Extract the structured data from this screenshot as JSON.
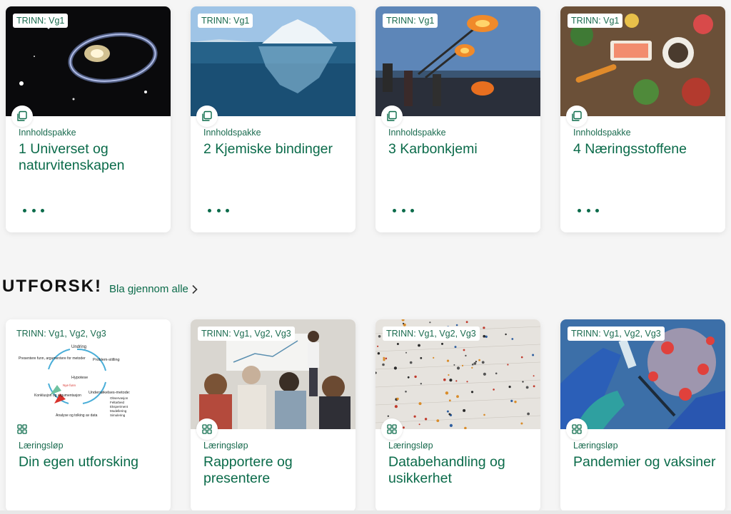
{
  "top_cards": [
    {
      "tag": "TRINN: Vg1",
      "kind": "Innholdspakke",
      "title": "1 Universet og naturvitenskapen"
    },
    {
      "tag": "TRINN: Vg1",
      "kind": "Innholdspakke",
      "title": "2 Kjemiske bindinger"
    },
    {
      "tag": "TRINN: Vg1",
      "kind": "Innholdspakke",
      "title": "3 Karbonkjemi"
    },
    {
      "tag": "TRINN: Vg1",
      "kind": "Innholdspakke",
      "title": "4 Næringsstoffene"
    }
  ],
  "explore": {
    "heading": "UTFORSK!",
    "browse_label": "Bla gjennom alle"
  },
  "bottom_cards": [
    {
      "tag": "TRINN: Vg1, Vg2, Vg3",
      "kind": "Læringsløp",
      "title": "Din egen utforsking",
      "diagram": {
        "top": "Undring",
        "right": "Problem-stilling",
        "center": "Hypotese",
        "bottom_right": "Undersøkelses-metode:",
        "bottom": "Analyse og tolking av data",
        "left": "Konklusjon og argumentasjon",
        "top_left": "Presentere funn, argumentere for metoder",
        "arrow": "Nye funn",
        "list": [
          "Observasjon",
          "Feltarbeid",
          "Eksperiment",
          "Modellering",
          "Simulering"
        ]
      }
    },
    {
      "tag": "TRINN: Vg1, Vg2, Vg3",
      "kind": "Læringsløp",
      "title": "Rapportere og presentere"
    },
    {
      "tag": "TRINN: Vg1, Vg2, Vg3",
      "kind": "Læringsløp",
      "title": "Databehandling og usikkerhet"
    },
    {
      "tag": "TRINN: Vg1, Vg2, Vg3",
      "kind": "Læringsløp",
      "title": "Pandemier og vaksiner"
    }
  ],
  "colors": {
    "accent": "#0b6b4a",
    "background": "#f5f5f5",
    "card": "#ffffff"
  }
}
